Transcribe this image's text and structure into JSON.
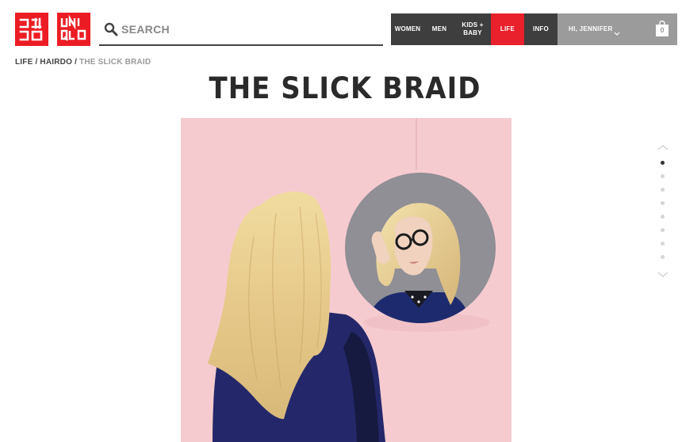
{
  "brand": {
    "logo_left": "ユニクロ",
    "logo_right": "UNI QLO",
    "color": "#ec1c24"
  },
  "search": {
    "placeholder": "SEARCH"
  },
  "nav": {
    "women": "WOMEN",
    "men": "MEN",
    "kids_line1": "KIDS +",
    "kids_line2": "BABY",
    "life": "LIFE",
    "info": "INFO",
    "active": "LIFE",
    "active_color": "#e8212c"
  },
  "account": {
    "greeting": "HI, JENNIFER",
    "cart_count": "0"
  },
  "breadcrumb": {
    "items": [
      "LIFE",
      "HAIRDO",
      "THE SLICK BRAID"
    ]
  },
  "page": {
    "title": "THE SLICK BRAID"
  },
  "pager": {
    "total": 8,
    "active": 1
  },
  "icons": {
    "search": "search-icon",
    "cart": "shopping-bag-icon",
    "up": "chevron-up-icon",
    "down": "chevron-down-icon",
    "account": "chevron-down-icon"
  }
}
